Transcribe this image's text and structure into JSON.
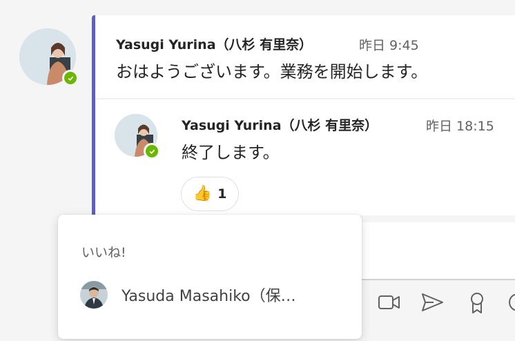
{
  "messages": [
    {
      "author": "Yasugi Yurina（八杉 有里奈）",
      "time": "昨日 9:45",
      "text": "おはようございます。業務を開始します。",
      "presence": "available"
    },
    {
      "author": "Yasugi Yurina（八杉 有里奈）",
      "time": "昨日 18:15",
      "text": "終了します。",
      "presence": "available",
      "reactions": [
        {
          "emoji": "👍",
          "icon": "thumbs-up-icon",
          "count": "1"
        }
      ]
    }
  ],
  "reaction_popup": {
    "title": "いいね!",
    "users": [
      {
        "name": "Yasuda Masahiko（保…"
      }
    ]
  },
  "compose_toolbar": {
    "icons": [
      "video-icon",
      "send-icon",
      "praise-icon",
      "more-icon"
    ]
  },
  "colors": {
    "accent": "#5b5fc7",
    "presence_available": "#6bb700",
    "background": "#f5f5f5"
  }
}
